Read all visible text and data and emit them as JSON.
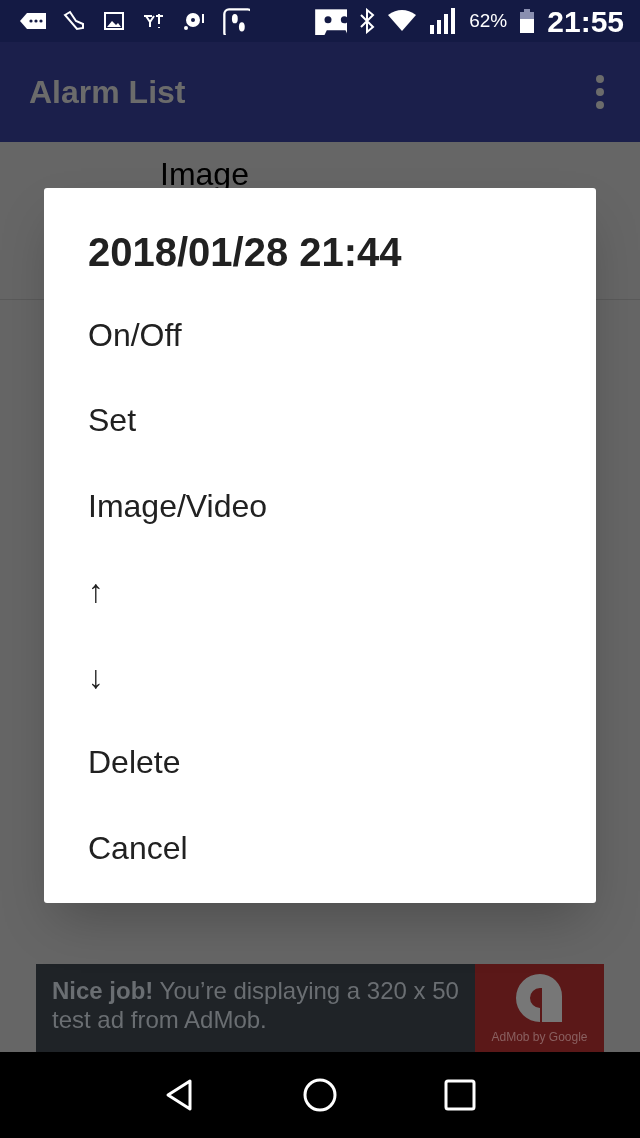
{
  "status_bar": {
    "battery": "62%",
    "time": "21:55"
  },
  "app_bar": {
    "title": "Alarm List"
  },
  "list": {
    "items": [
      {
        "label": "Image"
      }
    ]
  },
  "dialog": {
    "title": "2018/01/28 21:44",
    "items": [
      "On/Off",
      "Set",
      "Image/Video",
      "↑",
      "↓",
      "Delete",
      "Cancel"
    ]
  },
  "ad": {
    "text": "**Nice job!** You’re displaying a 320 x 50 test ad from AdMob.",
    "brand": "AdMob by Google"
  }
}
